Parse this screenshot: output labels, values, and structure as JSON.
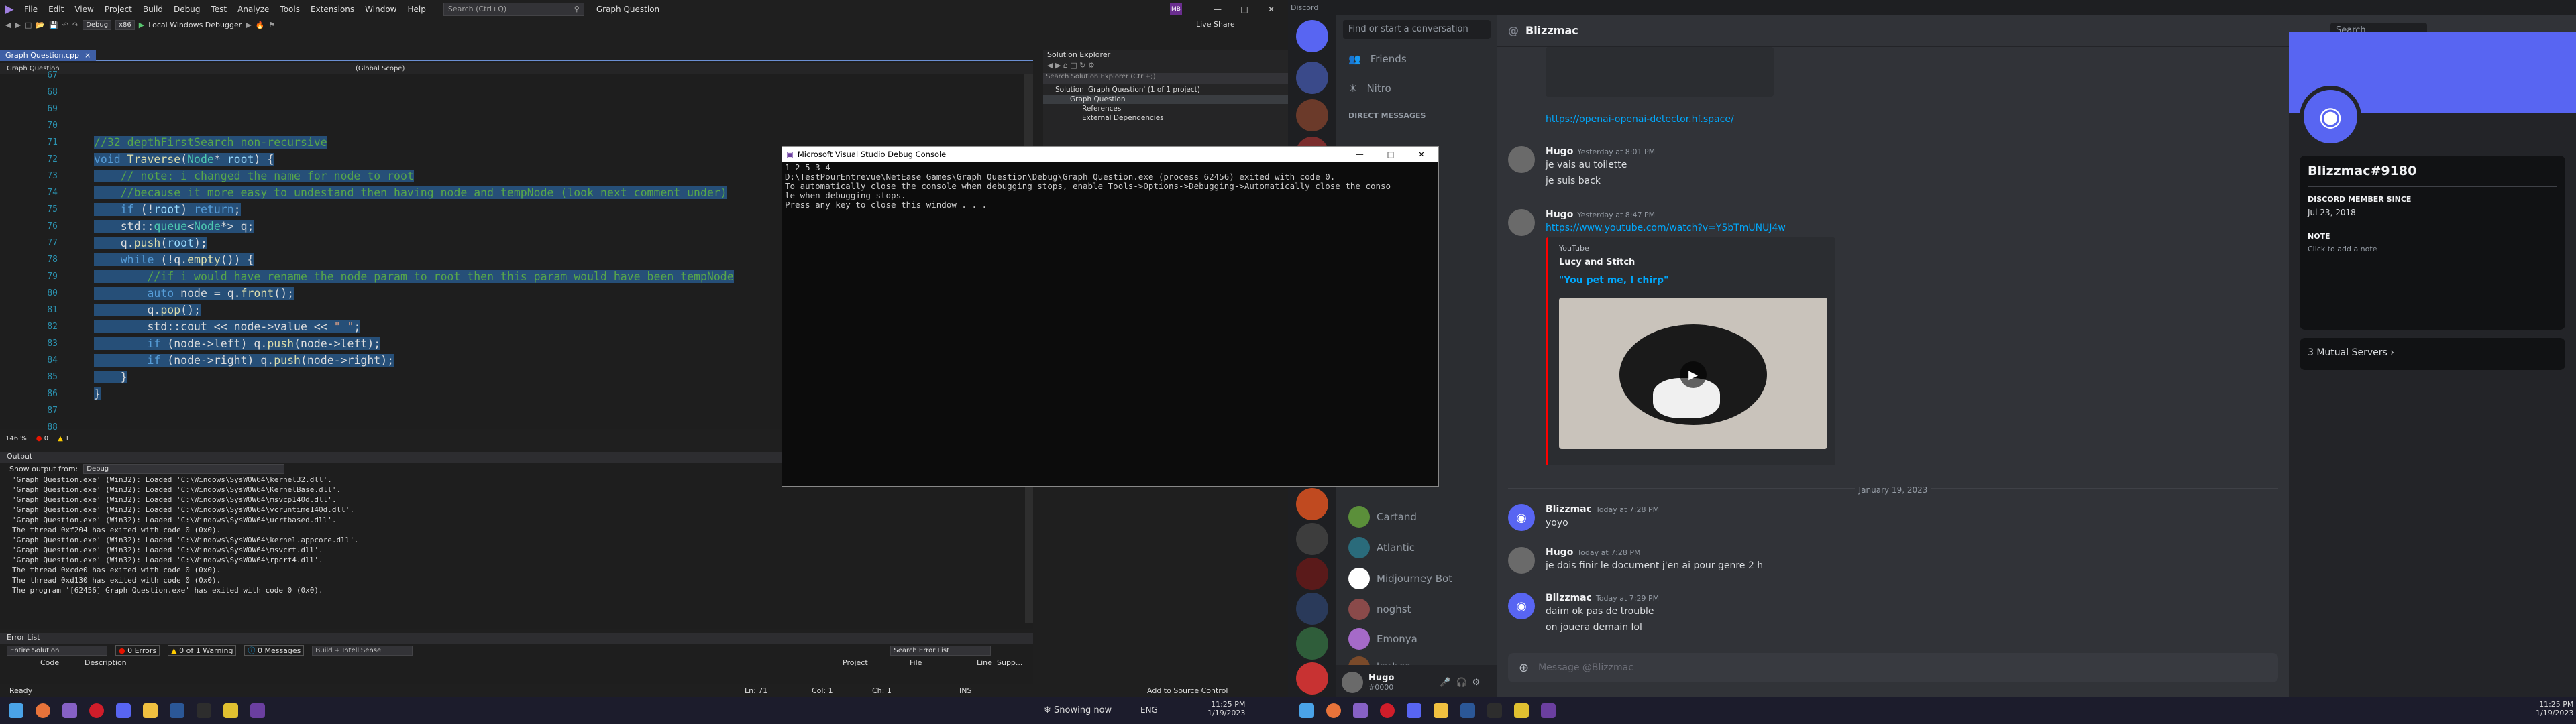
{
  "vs": {
    "menus": [
      "File",
      "Edit",
      "View",
      "Project",
      "Build",
      "Debug",
      "Test",
      "Analyze",
      "Tools",
      "Extensions",
      "Window",
      "Help"
    ],
    "search_placeholder": "Search (Ctrl+Q)",
    "title": "Graph Question",
    "user_initials": "MB",
    "toolbar": {
      "config": "Debug",
      "platform": "x86",
      "run_label": "Local Windows Debugger",
      "live_share": "Live Share"
    },
    "tab": {
      "label": "Graph Question.cpp",
      "close": "×"
    },
    "nav": {
      "file": "Graph Question",
      "scope": "(Global Scope)"
    },
    "code_lines": [
      {
        "n": "67",
        "segs": []
      },
      {
        "n": "68",
        "segs": []
      },
      {
        "n": "69",
        "segs": []
      },
      {
        "n": "70",
        "segs": []
      },
      {
        "n": "71",
        "segs": [
          [
            "cm",
            "//32 depthFirstSearch non-recursive"
          ]
        ]
      },
      {
        "n": "72",
        "segs": [
          [
            "kw",
            "void "
          ],
          [
            "fn",
            "Traverse"
          ],
          [
            "",
            "("
          ],
          [
            "ty",
            "Node"
          ],
          [
            "",
            "* "
          ],
          [
            "pm",
            "root"
          ],
          [
            "",
            ") {"
          ]
        ]
      },
      {
        "n": "73",
        "segs": [
          [
            "",
            "    "
          ],
          [
            "cm",
            "// note: i changed the name for node to root"
          ]
        ]
      },
      {
        "n": "74",
        "segs": [
          [
            "",
            "    "
          ],
          [
            "cm",
            "//because it more easy to undestand then having node and tempNode (look next comment under)"
          ]
        ]
      },
      {
        "n": "75",
        "segs": [
          [
            "",
            "    "
          ],
          [
            "kw",
            "if "
          ],
          [
            "",
            "(!"
          ],
          [
            "pm",
            "root"
          ],
          [
            "",
            ") "
          ],
          [
            "kw",
            "return"
          ],
          [
            "",
            ";"
          ]
        ]
      },
      {
        "n": "76",
        "segs": [
          [
            "",
            "    std::"
          ],
          [
            "ty",
            "queue"
          ],
          [
            "",
            "<"
          ],
          [
            "ty",
            "Node"
          ],
          [
            "",
            "*> q;"
          ]
        ]
      },
      {
        "n": "77",
        "segs": [
          [
            "",
            "    q."
          ],
          [
            "fn",
            "push"
          ],
          [
            "",
            "("
          ],
          [
            "pm",
            "root"
          ],
          [
            "",
            ");"
          ]
        ]
      },
      {
        "n": "78",
        "segs": [
          [
            "",
            "    "
          ],
          [
            "kw",
            "while "
          ],
          [
            "",
            "(!q."
          ],
          [
            "fn",
            "empty"
          ],
          [
            "",
            "()) {"
          ]
        ]
      },
      {
        "n": "79",
        "segs": [
          [
            "",
            "        "
          ],
          [
            "cm",
            "//if i would have rename the node param to root then this param would have been tempNode"
          ]
        ]
      },
      {
        "n": "80",
        "segs": [
          [
            "",
            "        "
          ],
          [
            "kw",
            "auto "
          ],
          [
            "",
            "node = q."
          ],
          [
            "fn",
            "front"
          ],
          [
            "",
            "();"
          ]
        ]
      },
      {
        "n": "81",
        "segs": [
          [
            "",
            "        q."
          ],
          [
            "fn",
            "pop"
          ],
          [
            "",
            "();"
          ]
        ]
      },
      {
        "n": "82",
        "segs": [
          [
            "",
            "        std::cout << node->value << "
          ],
          [
            "st",
            "\" \""
          ],
          [
            "",
            ";"
          ]
        ]
      },
      {
        "n": "83",
        "segs": [
          [
            "",
            "        "
          ],
          [
            "kw",
            "if "
          ],
          [
            "",
            "(node->left) q."
          ],
          [
            "fn",
            "push"
          ],
          [
            "",
            "(node->left);"
          ]
        ]
      },
      {
        "n": "84",
        "segs": [
          [
            "",
            "        "
          ],
          [
            "kw",
            "if "
          ],
          [
            "",
            "(node->right) q."
          ],
          [
            "fn",
            "push"
          ],
          [
            "",
            "(node->right);"
          ]
        ]
      },
      {
        "n": "85",
        "segs": [
          [
            "",
            "    }"
          ]
        ]
      },
      {
        "n": "86",
        "segs": [
          [
            "",
            "}"
          ]
        ]
      },
      {
        "n": "87",
        "segs": []
      },
      {
        "n": "88",
        "segs": []
      }
    ],
    "editor_status": {
      "zoom": "146 %",
      "errors": "0",
      "warnings": "1"
    },
    "solution": {
      "title": "Solution Explorer",
      "search": "Search Solution Explorer (Ctrl+;)",
      "items": [
        "Solution 'Graph Question' (1 of 1 project)",
        "Graph Question",
        "References",
        "External Dependencies"
      ]
    },
    "output": {
      "title": "Output",
      "from_label": "Show output from:",
      "from_value": "Debug",
      "lines": [
        "'Graph Question.exe' (Win32): Loaded 'C:\\Windows\\SysWOW64\\kernel32.dll'.",
        "'Graph Question.exe' (Win32): Loaded 'C:\\Windows\\SysWOW64\\KernelBase.dll'.",
        "'Graph Question.exe' (Win32): Loaded 'C:\\Windows\\SysWOW64\\msvcp140d.dll'.",
        "'Graph Question.exe' (Win32): Loaded 'C:\\Windows\\SysWOW64\\vcruntime140d.dll'.",
        "'Graph Question.exe' (Win32): Loaded 'C:\\Windows\\SysWOW64\\ucrtbased.dll'.",
        "The thread 0xf204 has exited with code 0 (0x0).",
        "'Graph Question.exe' (Win32): Loaded 'C:\\Windows\\SysWOW64\\kernel.appcore.dll'.",
        "'Graph Question.exe' (Win32): Loaded 'C:\\Windows\\SysWOW64\\msvcrt.dll'.",
        "'Graph Question.exe' (Win32): Loaded 'C:\\Windows\\SysWOW64\\rpcrt4.dll'.",
        "The thread 0xcde0 has exited with code 0 (0x0).",
        "The thread 0xd130 has exited with code 0 (0x0).",
        "The program '[62456] Graph Question.exe' has exited with code 0 (0x0)."
      ]
    },
    "errors": {
      "title": "Error List",
      "scope": "Entire Solution",
      "errors": "0 Errors",
      "warnings": "0 of 1 Warning",
      "messages": "0 Messages",
      "build": "Build + IntelliSense",
      "search": "Search Error List",
      "columns": [
        "Code",
        "Description",
        "Project",
        "File",
        "Line",
        "Supp..."
      ]
    },
    "status": {
      "ready": "Ready",
      "ln": "Ln: 71",
      "col": "Col: 1",
      "ch": "Ch: 1",
      "ins": "INS",
      "source_control": "Add to Source Control"
    }
  },
  "console": {
    "title": "Microsoft Visual Studio Debug Console",
    "lines": [
      "1 2 5 3 4",
      "D:\\TestPourEntrevue\\NetEase Games\\Graph Question\\Debug\\Graph Question.exe (process 62456) exited with code 0.",
      "To automatically close the console when debugging stops, enable Tools->Options->Debugging->Automatically close the conso",
      "le when debugging stops.",
      "Press any key to close this window . . ."
    ]
  },
  "discord": {
    "app_title": "Discord",
    "search": "Find or start a conversation",
    "nav": [
      "Friends",
      "Nitro"
    ],
    "dm_header": "DIRECT MESSAGES",
    "dms": [
      "Cartand",
      "Atlantic",
      "Midjourney Bot",
      "noghst",
      "Emonya",
      "kmhgn"
    ],
    "user": {
      "name": "Hugo",
      "tag": "#0000"
    },
    "channel": "Blizzmac",
    "header_search": "Search",
    "messages": [
      {
        "name": "Hugo",
        "time": "Yesterday at 8:01 PM",
        "lines": [
          "je vais au toilette",
          "je suis back"
        ]
      },
      {
        "name": "Hugo",
        "time": "Yesterday at 8:47 PM",
        "lines": [
          "https://www.youtube.com/watch?v=Y5bTmUNUJ4w"
        ]
      },
      {
        "name": "Blizzmac",
        "time": "Today at 7:28 PM",
        "lines": [
          "yoyo"
        ]
      },
      {
        "name": "Hugo",
        "time": "Today at 7:28 PM",
        "lines": [
          "je dois finir le document j'en ai pour genre 2 h"
        ]
      },
      {
        "name": "Blizzmac",
        "time": "Today at 7:29 PM",
        "lines": [
          "daim ok pas de trouble",
          "on jouera demain lol"
        ]
      }
    ],
    "link_top": "https://openai-openai-detector.hf.space/",
    "embed": {
      "provider": "YouTube",
      "author": "Lucy and Stitch",
      "title": "\"You pet me, I chirp\""
    },
    "date_divider": "January 19, 2023",
    "input_placeholder": "Message @Blizzmac",
    "profile": {
      "name": "Blizzmac#9180",
      "member_since_label": "DISCORD MEMBER SINCE",
      "member_since": "Jul 23, 2018",
      "note_label": "NOTE",
      "note_placeholder": "Click to add a note",
      "mutual": "3 Mutual Servers"
    }
  },
  "taskbar": {
    "weather": "Snowing now",
    "lang": "ENG",
    "time_left": "11:25 PM",
    "date_left": "1/19/2023",
    "time_right": "11:25 PM",
    "date_right": "1/19/2023"
  },
  "colors": {
    "vs_accent": "#6b8fd2",
    "selection": "#264f78",
    "discord_blurple": "#5865f2",
    "taskbar": "#1c1c2c"
  }
}
